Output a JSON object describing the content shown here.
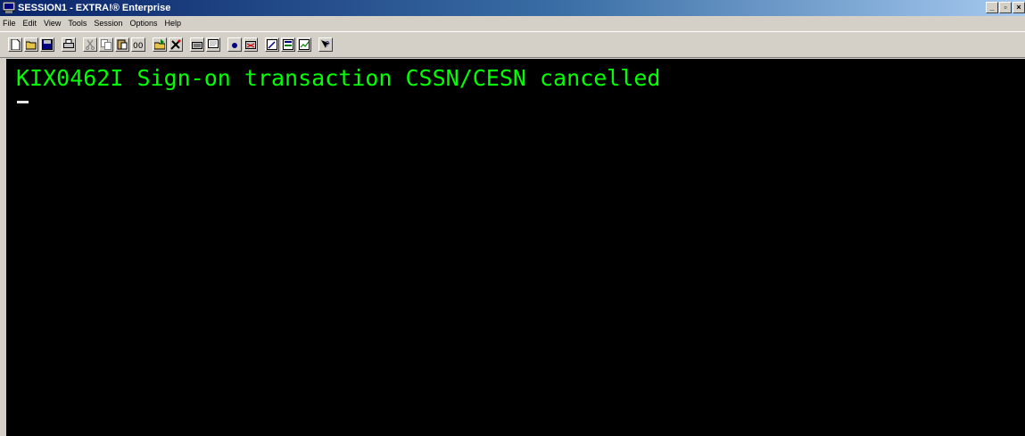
{
  "window": {
    "title": "SESSION1 - EXTRA!® Enterprise",
    "controls": [
      "minimize",
      "maximize",
      "close"
    ]
  },
  "menu": {
    "items": [
      {
        "label": "File"
      },
      {
        "label": "Edit"
      },
      {
        "label": "View"
      },
      {
        "label": "Tools"
      },
      {
        "label": "Session"
      },
      {
        "label": "Options"
      },
      {
        "label": "Help"
      }
    ]
  },
  "toolbar": {
    "buttons": [
      {
        "name": "new-icon"
      },
      {
        "name": "open-icon"
      },
      {
        "name": "save-icon"
      },
      {
        "name": "print-icon"
      },
      {
        "name": "cut-icon"
      },
      {
        "name": "copy-icon"
      },
      {
        "name": "paste-icon"
      },
      {
        "name": "macro-icon"
      },
      {
        "name": "transfer-icon"
      },
      {
        "name": "tools-icon"
      },
      {
        "name": "keyboard-icon"
      },
      {
        "name": "session-icon"
      },
      {
        "name": "record-icon"
      },
      {
        "name": "connect-icon"
      },
      {
        "name": "edit-settings-icon"
      },
      {
        "name": "settings-icon"
      },
      {
        "name": "macro-edit-icon"
      },
      {
        "name": "help-icon"
      }
    ]
  },
  "screen": {
    "message": "KIX0462I Sign-on transaction CSSN/CESN cancelled",
    "text_color": "#00ff00",
    "background": "#000000"
  }
}
